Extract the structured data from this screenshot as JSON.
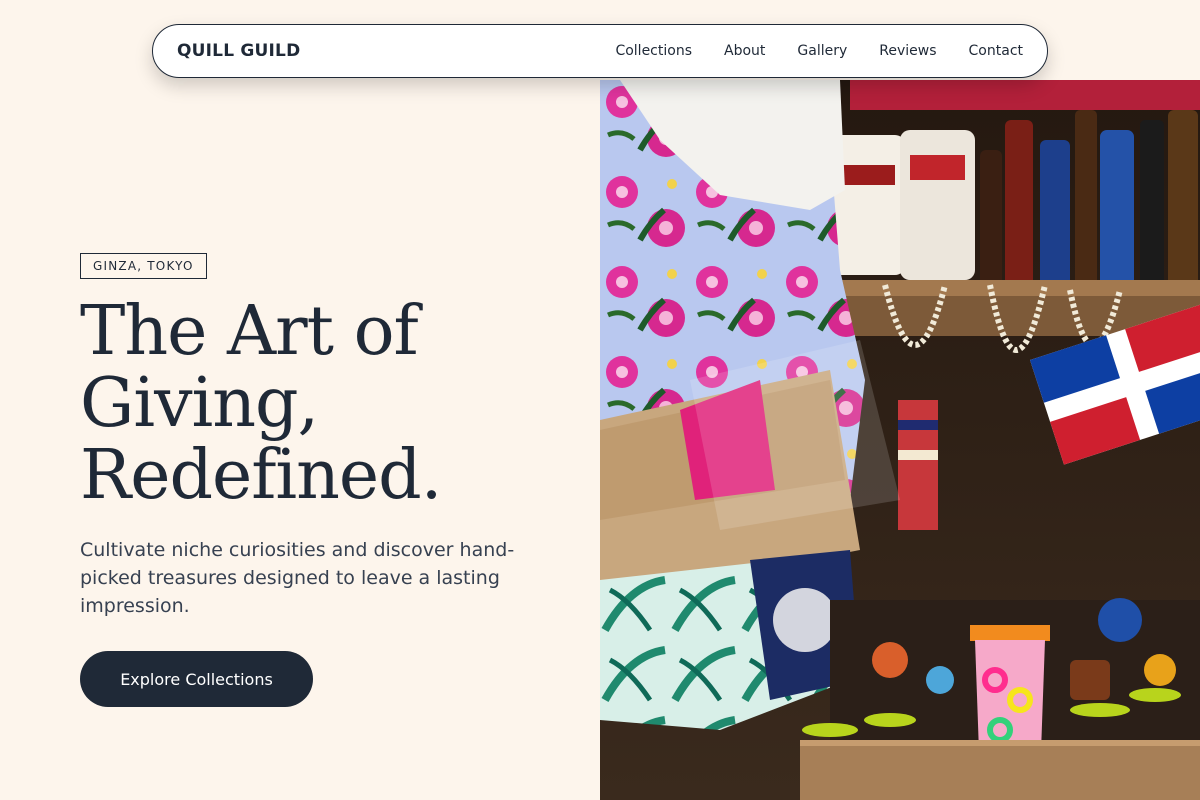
{
  "nav": {
    "brand": "QUILL GUILD",
    "links": [
      "Collections",
      "About",
      "Gallery",
      "Reviews",
      "Contact"
    ]
  },
  "hero": {
    "location": "GINZA, TOKYO",
    "headline": [
      "The Art of",
      "Giving,",
      "Redefined."
    ],
    "subhead": "Cultivate niche curiosities and discover hand-picked treasures designed to leave a lasting impression.",
    "cta_label": "Explore Collections",
    "image_alt": "Market stall with colorful floral fabrics, shell necklaces, bottles and a flag"
  },
  "colors": {
    "background": "#fdf5ec",
    "ink": "#1f2937",
    "button": "#1f2937"
  }
}
